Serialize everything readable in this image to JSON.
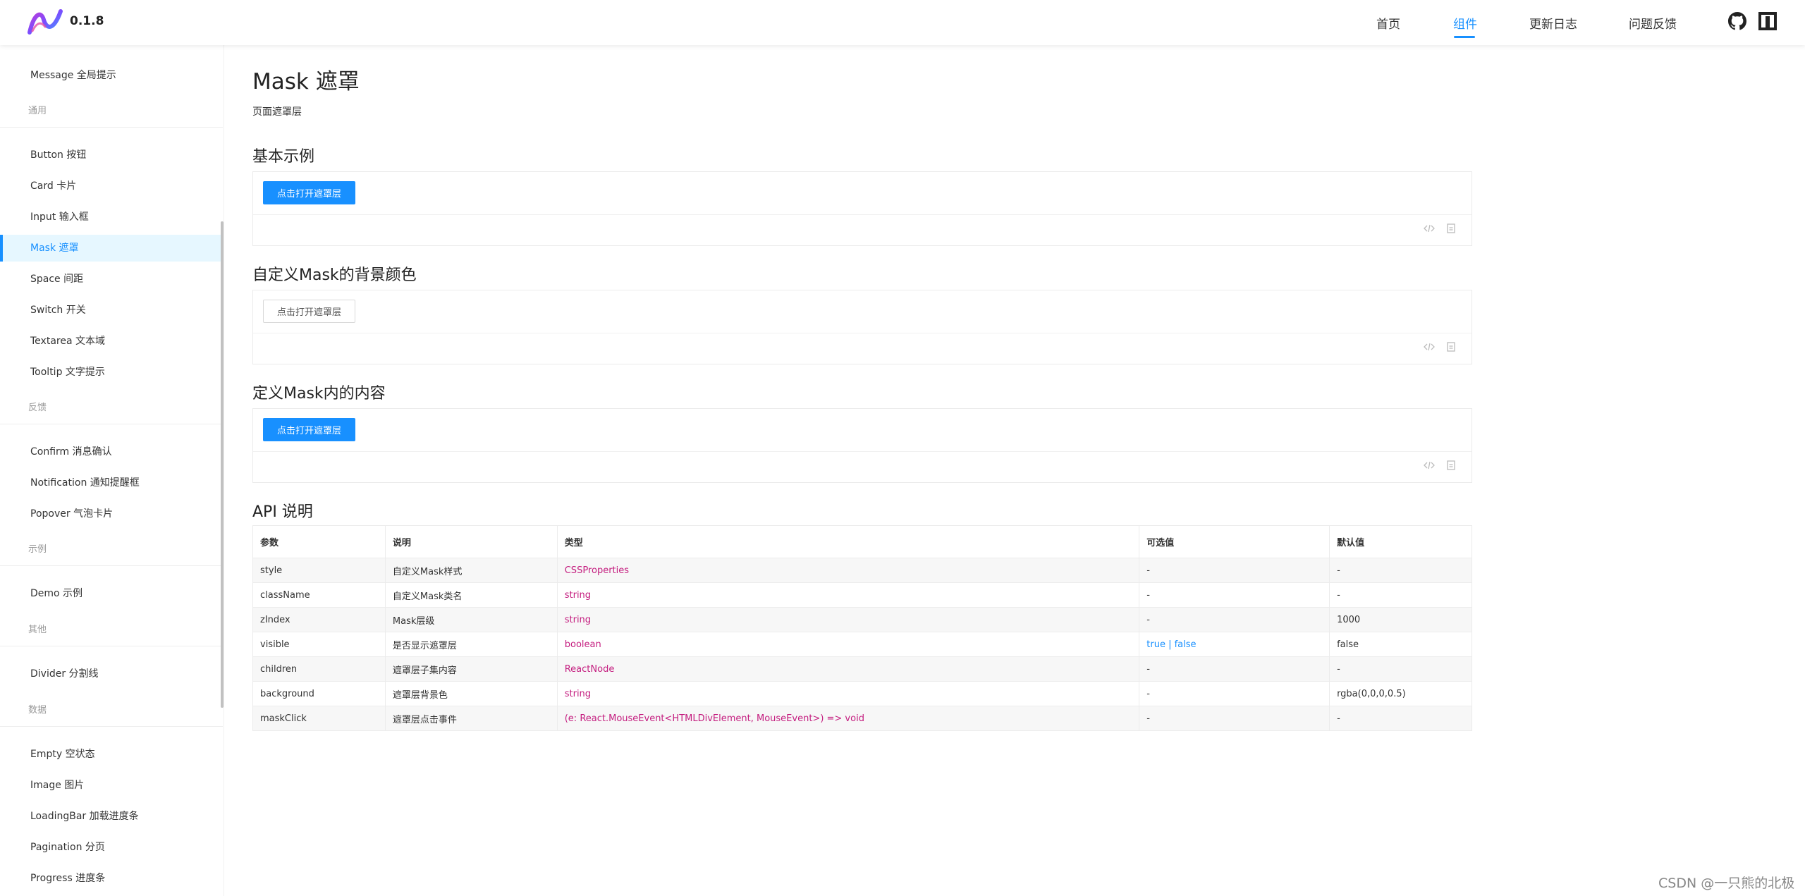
{
  "header": {
    "version": "0.1.8",
    "nav": [
      {
        "label": "首页"
      },
      {
        "label": "组件"
      },
      {
        "label": "更新日志"
      },
      {
        "label": "问题反馈"
      }
    ],
    "active_nav": "组件",
    "icons": [
      "github-icon",
      "gitee-icon"
    ]
  },
  "sidebar": {
    "items": {
      "message": "Message 全局提示",
      "button": "Button 按钮",
      "card": "Card 卡片",
      "input": "Input 输入框",
      "mask": "Mask 遮罩",
      "space": "Space 间距",
      "switch": "Switch 开关",
      "textarea": "Textarea 文本域",
      "tooltip": "Tooltip 文字提示",
      "confirm": "Confirm 消息确认",
      "notification": "Notification 通知提醒框",
      "popover": "Popover 气泡卡片",
      "demo": "Demo 示例",
      "divider": "Divider 分割线",
      "empty": "Empty 空状态",
      "image": "Image 图片",
      "loadingbar": "LoadingBar 加载进度条",
      "pagination": "Pagination 分页",
      "progress": "Progress 进度条"
    },
    "groups": {
      "general": "通用",
      "feedback": "反馈",
      "example": "示例",
      "other": "其他",
      "data": "数据"
    },
    "active_item": "Mask 遮罩"
  },
  "main": {
    "title": "Mask 遮罩",
    "description": "页面遮罩层",
    "sections": [
      {
        "title": "基本示例",
        "button": "点击打开遮罩层"
      },
      {
        "title": "自定义Mask的背景颜色",
        "button": "点击打开遮罩层"
      },
      {
        "title": "定义Mask内的内容",
        "button": "点击打开遮罩层"
      }
    ],
    "api_title": "API 说明",
    "api_table": {
      "headers": [
        "参数",
        "说明",
        "类型",
        "可选值",
        "默认值"
      ],
      "rows": [
        [
          "style",
          "自定义Mask样式",
          "CSSProperties",
          "-",
          "-"
        ],
        [
          "className",
          "自定义Mask类名",
          "string",
          "-",
          "-"
        ],
        [
          "zIndex",
          "Mask层级",
          "string",
          "-",
          "1000"
        ],
        [
          "visible",
          "是否显示遮罩层",
          "boolean",
          "true | false",
          "false"
        ],
        [
          "children",
          "遮罩层子集内容",
          "ReactNode",
          "-",
          "-"
        ],
        [
          "background",
          "遮罩层背景色",
          "string",
          "-",
          "rgba(0,0,0,0.5)"
        ],
        [
          "maskClick",
          "遮罩层点击事件",
          "(e: React.MouseEvent<HTMLDivElement, MouseEvent>) => void",
          "-",
          "-"
        ]
      ]
    }
  },
  "watermark": "CSDN @一只熊的北极",
  "colors": {
    "accent": "#1890ff",
    "type_text": "#c41d7f",
    "active_bg": "#e6f7ff"
  }
}
